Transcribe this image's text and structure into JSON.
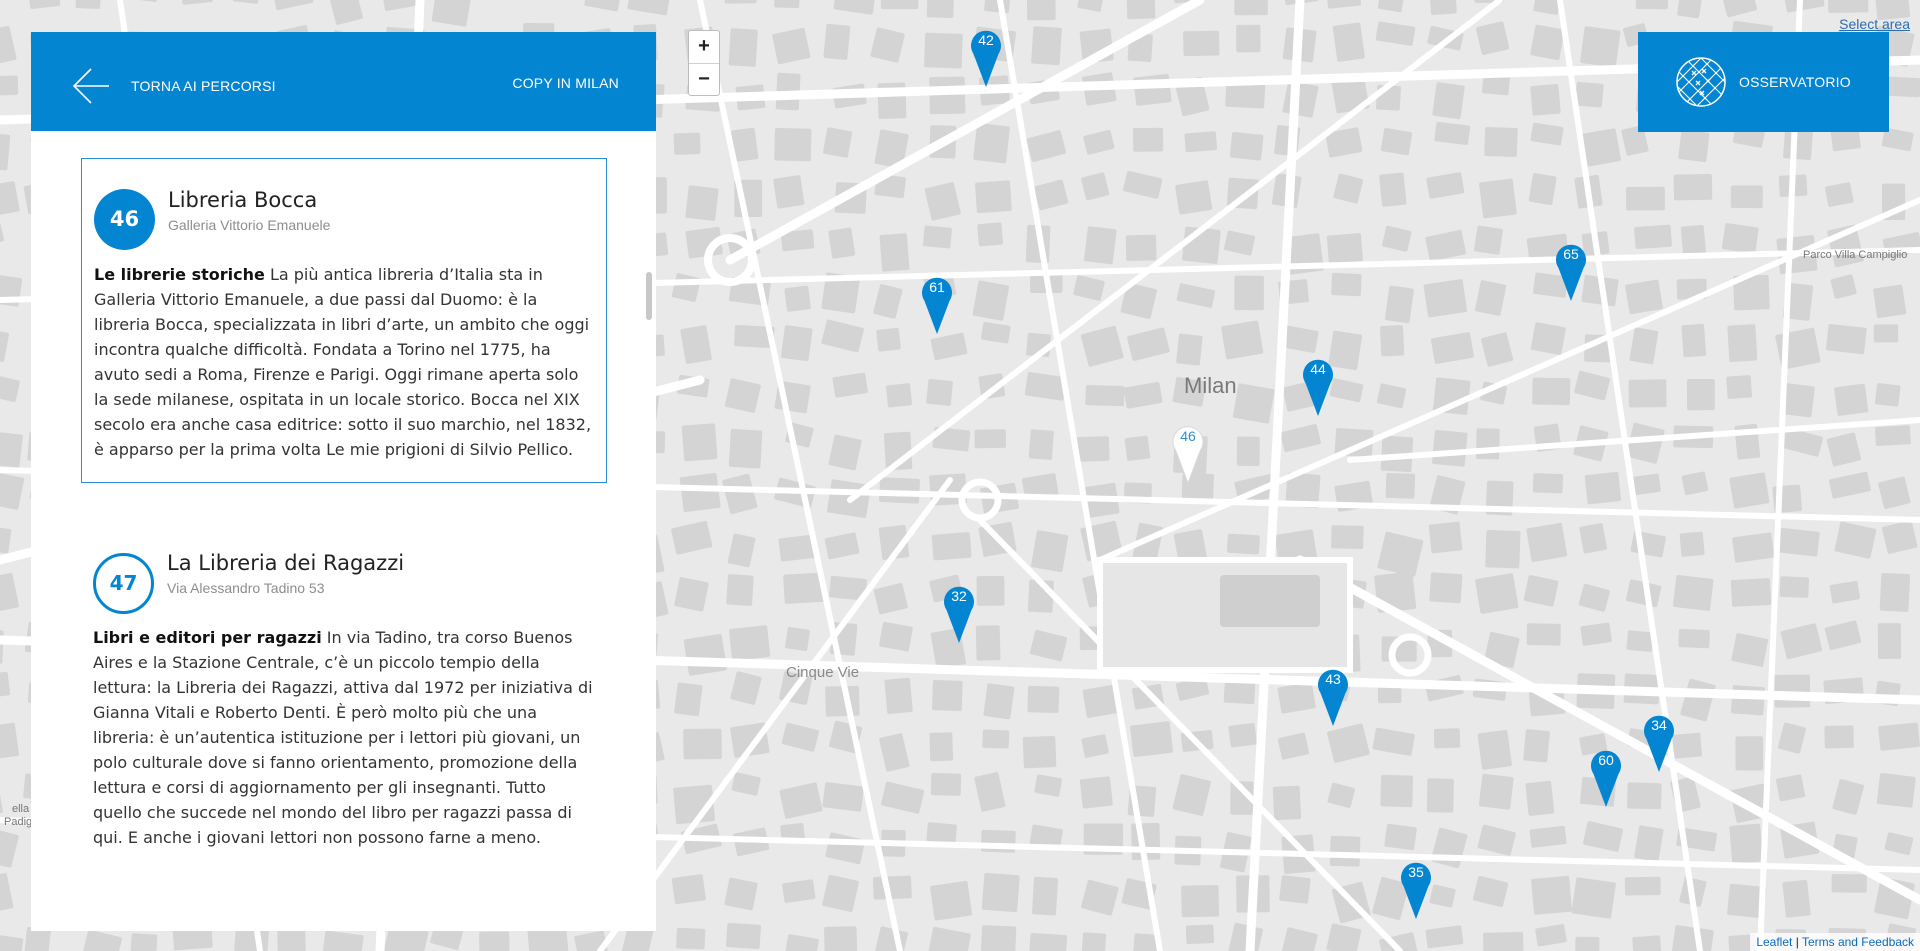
{
  "header": {
    "back_label": "TORNA AI PERCORSI",
    "copy_label": "COPY IN MILAN",
    "observatory_label": "OSSERVATORIO"
  },
  "cards": [
    {
      "number": "46",
      "title": "Libreria Bocca",
      "subtitle": "Galleria Vittorio Emanuele",
      "lead": "Le librerie storiche",
      "text": "La più antica libreria d’Italia sta in Galleria Vittorio Emanuele, a due passi dal Duomo: è la libreria Bocca, specializzata in libri d’arte, un ambito che oggi incontra qualche difficoltà. Fondata a Torino nel 1775, ha avuto sedi a Roma, Firenze e Parigi. Oggi rimane aperta solo la sede milanese, ospitata in un locale storico. Bocca nel XIX secolo era anche casa editrice: sotto il suo marchio, nel 1832, è apparso per la prima volta Le mie prigioni di Silvio Pellico.",
      "active": true
    },
    {
      "number": "47",
      "title": "La Libreria dei Ragazzi",
      "subtitle": "Via Alessandro Tadino 53",
      "lead": "Libri e editori per ragazzi",
      "text": "In via Tadino, tra corso Buenos Aires e la Stazione Centrale, c’è un piccolo tempio della lettura: la Libreria dei Ragazzi, attiva dal 1972 per iniziativa di Gianna Vitali e Roberto Denti. È però molto più che una libreria: è un’autentica istituzione per i lettori più giovani, un polo culturale dove si fanno orientamento, promozione della lettura e corsi di aggiornamento per gli insegnanti. Tutto quello che succede nel mondo del libro per ragazzi passa di qui. E anche i giovani lettori non possono farne a meno.",
      "active": false
    }
  ],
  "map": {
    "zoom_in": "+",
    "zoom_out": "−",
    "select_area": "Select area",
    "labels": {
      "city": "Milan",
      "district": "Cinque Vie",
      "park": "Parco Villa Campiglio",
      "edge_top": "ella",
      "edge_bottom": "Padig"
    },
    "markers": [
      "42",
      "61",
      "65",
      "44",
      "46",
      "32",
      "43",
      "34",
      "60",
      "35"
    ],
    "active_marker": "46",
    "attribution": {
      "leaflet": "Leaflet",
      "separator": " | ",
      "terms": "Terms and Feedback"
    }
  },
  "colors": {
    "brand_blue": "#0485d2",
    "map_background": "#e9e9e9",
    "building": "#d4d4d4",
    "road": "#ffffff"
  }
}
